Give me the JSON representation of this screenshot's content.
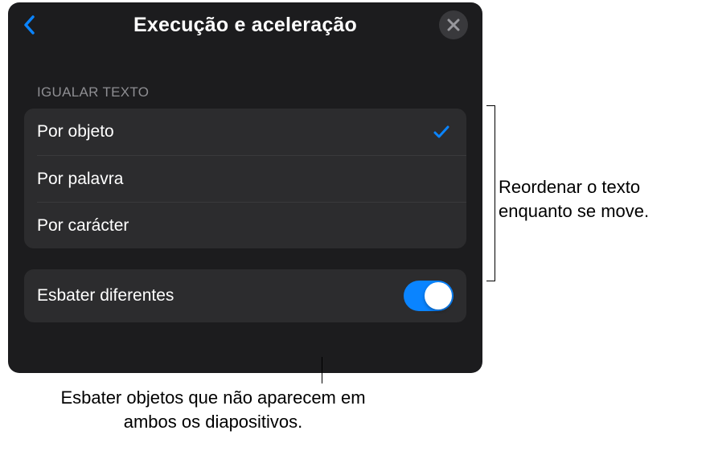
{
  "header": {
    "title": "Execução e aceleração"
  },
  "section": {
    "header": "Igualar texto"
  },
  "matchText": {
    "items": [
      {
        "label": "Por objeto",
        "selected": true
      },
      {
        "label": "Por palavra",
        "selected": false
      },
      {
        "label": "Por carácter",
        "selected": false
      }
    ]
  },
  "fadeToggle": {
    "label": "Esbater diferentes",
    "enabled": true
  },
  "callouts": {
    "right": "Reordenar o texto enquanto se move.",
    "bottom": "Esbater objetos que não aparecem em ambos os diapositivos."
  }
}
